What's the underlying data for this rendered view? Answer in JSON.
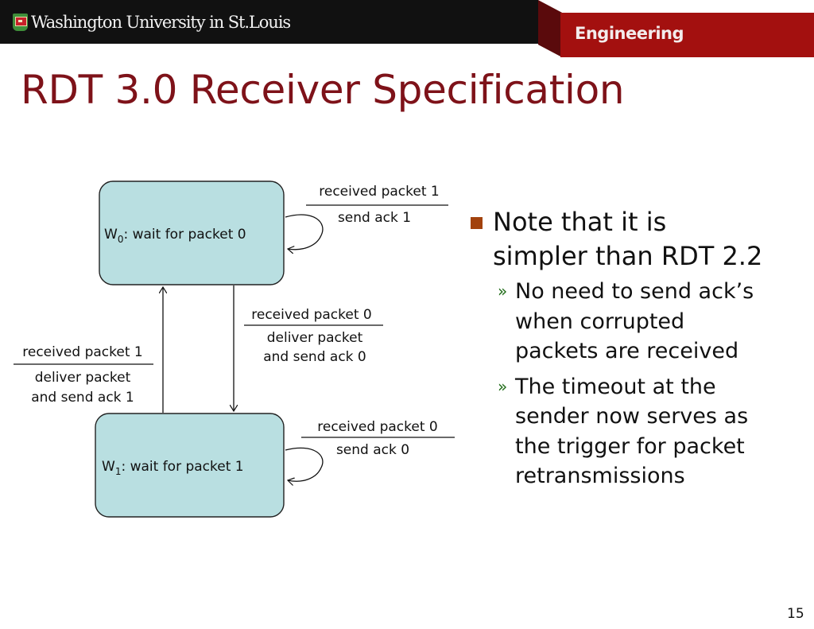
{
  "header": {
    "university": "Washington University in St.Louis",
    "school": "Engineering",
    "shield_icon": "university-shield-icon",
    "colors": {
      "bar": "#111111",
      "brand_red": "#a3100f",
      "title": "#7e1219"
    }
  },
  "slide": {
    "title": "RDT 3.0 Receiver Specification",
    "page_number": "15"
  },
  "diagram": {
    "state_fill": "#b9dfe1",
    "states": [
      {
        "id": "W0",
        "name": "W",
        "subscript": "0",
        "label": ": wait for packet 0"
      },
      {
        "id": "W1",
        "name": "W",
        "subscript": "1",
        "label": ": wait for packet 1"
      }
    ],
    "transitions": [
      {
        "from": "W0",
        "to": "W0",
        "event": "received packet 1",
        "action": [
          "send ack 1"
        ]
      },
      {
        "from": "W0",
        "to": "W1",
        "event": "received packet 0",
        "action": [
          "deliver packet",
          "and send ack 0"
        ]
      },
      {
        "from": "W1",
        "to": "W0",
        "event": "received packet 1",
        "action": [
          "deliver packet",
          "and send ack 1"
        ]
      },
      {
        "from": "W1",
        "to": "W1",
        "event": "received packet 0",
        "action": [
          "send ack 0"
        ]
      }
    ]
  },
  "bullets": {
    "main": "Note that it is simpler than RDT 2.2",
    "main_lines": [
      "Note that it is",
      "simpler than RDT 2.2"
    ],
    "marker_color": "#a2420d",
    "sub_marker": "»",
    "sub_marker_color": "#1e6b16",
    "subs": [
      {
        "lines": [
          "No need to send ack’s",
          "when corrupted",
          "packets are received"
        ]
      },
      {
        "lines": [
          "The timeout at the",
          "sender now serves as",
          "the trigger for packet",
          "retransmissions"
        ]
      }
    ]
  }
}
